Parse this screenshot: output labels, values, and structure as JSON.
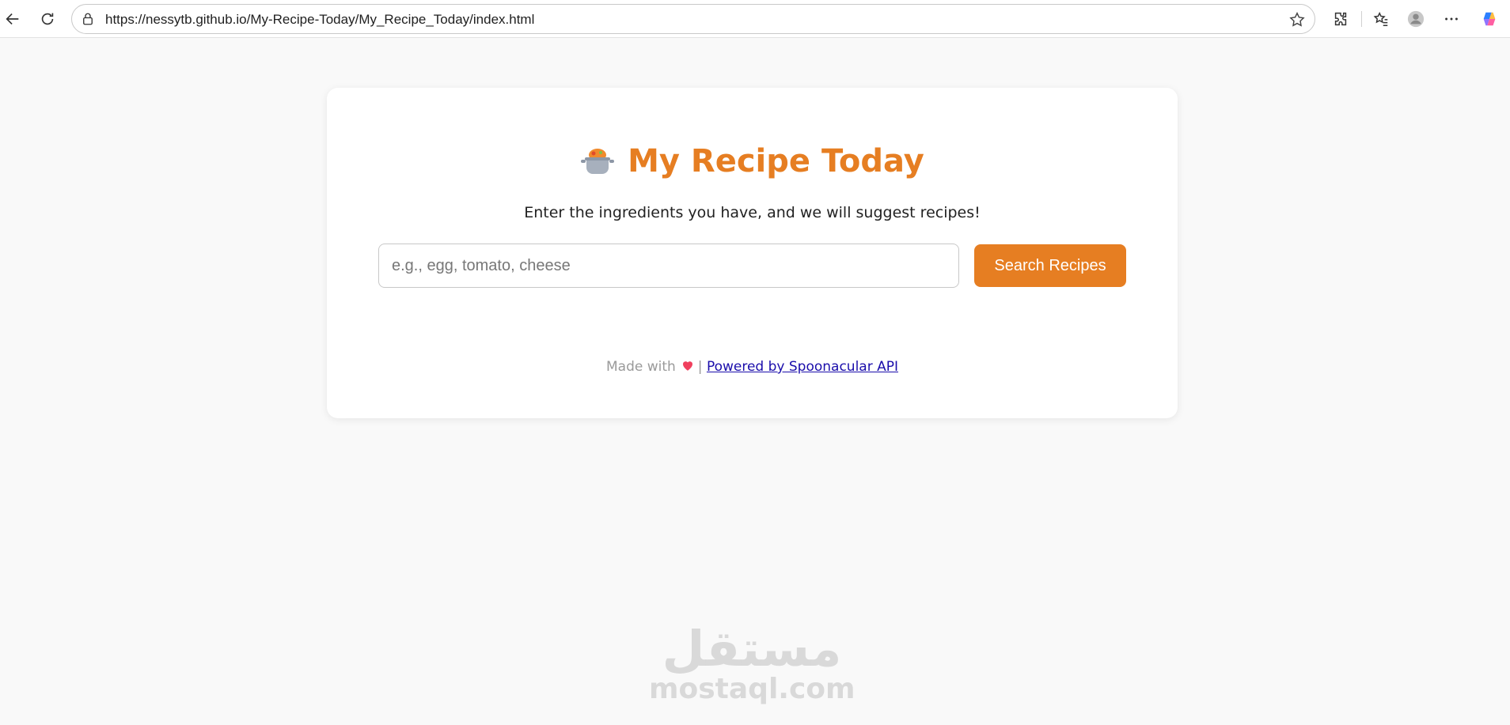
{
  "browser": {
    "url": "https://nessytb.github.io/My-Recipe-Today/My_Recipe_Today/index.html",
    "icons": [
      "back-icon",
      "reload-icon",
      "lock-icon",
      "star-icon",
      "extensions-icon",
      "favorites-icon",
      "profile-icon",
      "more-icon",
      "copilot-icon"
    ]
  },
  "card": {
    "title": "My Recipe Today",
    "title_icon": "cooking-pot-icon",
    "subtitle": "Enter the ingredients you have, and we will suggest recipes!",
    "search": {
      "placeholder": "e.g., egg, tomato, cheese",
      "value": "",
      "button_label": "Search Recipes"
    },
    "footer": {
      "made_with": "Made with",
      "heart_icon": "heart-icon",
      "separator": "|",
      "link_text": "Powered by Spoonacular API"
    }
  },
  "watermark": {
    "arabic": "مستقل",
    "latin": "mostaql.com"
  },
  "colors": {
    "accent": "#e67e22",
    "background": "#f9f9f9",
    "link": "#1a0dab"
  }
}
